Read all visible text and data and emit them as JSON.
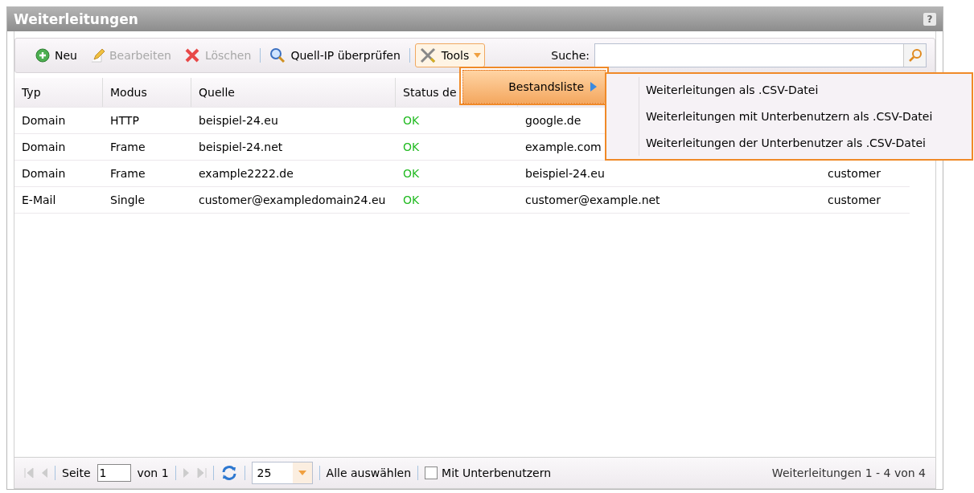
{
  "window": {
    "title": "Weiterleitungen",
    "help": "?"
  },
  "toolbar": {
    "buttons": [
      {
        "kind": "add",
        "label": "Neu",
        "disabled": false
      },
      {
        "kind": "edit",
        "label": "Bearbeiten",
        "disabled": true
      },
      {
        "kind": "delete",
        "label": "Löschen",
        "disabled": true
      },
      {
        "kind": "check",
        "label": "Quell-IP überprüfen",
        "disabled": false
      },
      {
        "kind": "tools",
        "label": "Tools",
        "disabled": false
      }
    ],
    "search": {
      "label": "Suche:"
    }
  },
  "menu": {
    "items": [
      {
        "label": "Bestandsliste",
        "selected": true
      }
    ],
    "submenu": [
      "Weiterleitungen als .CSV-Datei",
      "Weiterleitungen mit Unterbenutzern als .CSV-Datei",
      "Weiterleitungen der Unterbenutzer als .CSV-Datei"
    ]
  },
  "table": {
    "columns": [
      "Typ",
      "Modus",
      "Quelle",
      "Status de",
      "",
      ""
    ],
    "rows": [
      {
        "cells": [
          "Domain",
          "HTTP",
          "beispiel-24.eu",
          "OK",
          "google.de",
          ""
        ]
      },
      {
        "cells": [
          "Domain",
          "Frame",
          "beispiel-24.net",
          "OK",
          "example.com",
          ""
        ]
      },
      {
        "cells": [
          "Domain",
          "Frame",
          "example2222.de",
          "OK",
          "beispiel-24.eu",
          "customer"
        ]
      },
      {
        "cells": [
          "E-Mail",
          "Single",
          "customer@exampledomain24.eu",
          "OK",
          "customer@example.net",
          "customer"
        ]
      }
    ]
  },
  "paging": {
    "page_label": "Seite",
    "page": "1",
    "of_label": "von 1",
    "page_size": "25",
    "select_all": "Alle auswählen",
    "subusers": {
      "label": "Mit Unterbenutzern",
      "checked": false
    },
    "summary": "Weiterleitungen 1 - 4 von 4"
  }
}
